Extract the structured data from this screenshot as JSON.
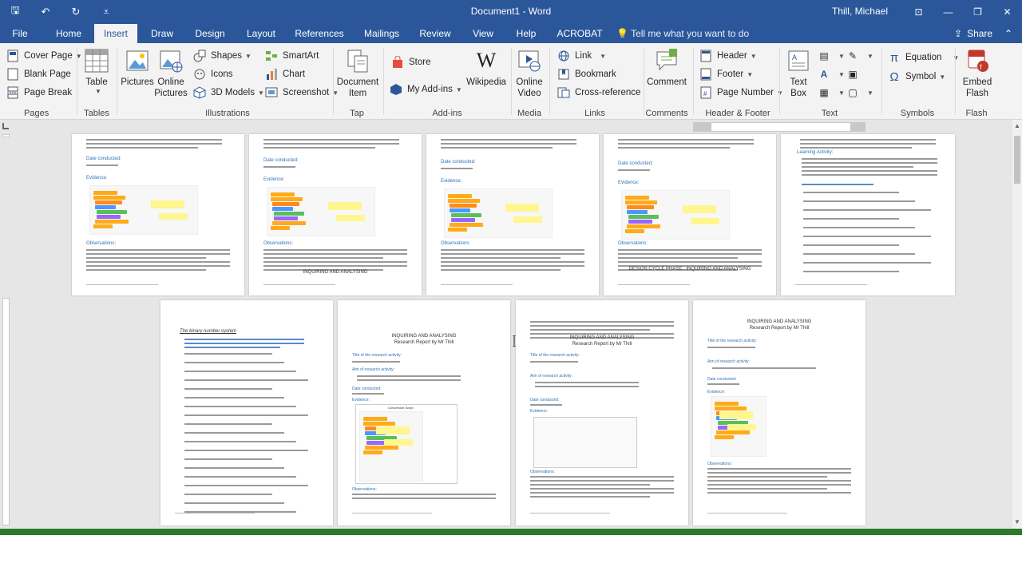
{
  "titlebar": {
    "doc_title": "Document1 - Word",
    "user": "Thill, Michael",
    "qat": [
      {
        "name": "save-icon",
        "glyph": "🖫"
      },
      {
        "name": "undo-icon",
        "glyph": "↶"
      },
      {
        "name": "redo-icon",
        "glyph": "↻"
      },
      {
        "name": "customize-qat-icon",
        "glyph": "⩡"
      }
    ],
    "window_controls": [
      {
        "name": "ribbon-display-options-icon",
        "glyph": "⊡"
      },
      {
        "name": "minimize-icon",
        "glyph": "—"
      },
      {
        "name": "restore-icon",
        "glyph": "❐"
      },
      {
        "name": "close-icon",
        "glyph": "✕"
      }
    ]
  },
  "tabs": {
    "items": [
      "File",
      "Home",
      "Insert",
      "Draw",
      "Design",
      "Layout",
      "References",
      "Mailings",
      "Review",
      "View",
      "Help",
      "ACROBAT"
    ],
    "active": "Insert",
    "tell_me": "Tell me what you want to do",
    "share": "Share"
  },
  "ribbon": {
    "pages": {
      "label": "Pages",
      "cover_page": "Cover Page",
      "blank_page": "Blank Page",
      "page_break": "Page Break"
    },
    "tables": {
      "label": "Tables",
      "table": "Table"
    },
    "illustrations": {
      "label": "Illustrations",
      "pictures": "Pictures",
      "online_pictures_1": "Online",
      "online_pictures_2": "Pictures",
      "shapes": "Shapes",
      "icons": "Icons",
      "models_3d": "3D Models",
      "smartart": "SmartArt",
      "chart": "Chart",
      "screenshot": "Screenshot"
    },
    "tap": {
      "label": "Tap",
      "document_item_1": "Document",
      "document_item_2": "Item"
    },
    "addins": {
      "label": "Add-ins",
      "store": "Store",
      "my_addins": "My Add-ins",
      "wikipedia": "Wikipedia"
    },
    "media": {
      "label": "Media",
      "online_video_1": "Online",
      "online_video_2": "Video"
    },
    "links": {
      "label": "Links",
      "link": "Link",
      "bookmark": "Bookmark",
      "cross_reference": "Cross-reference"
    },
    "comments": {
      "label": "Comments",
      "comment": "Comment"
    },
    "header_footer": {
      "label": "Header & Footer",
      "header": "Header",
      "footer": "Footer",
      "page_number": "Page Number"
    },
    "text": {
      "label": "Text",
      "text_box_1": "Text",
      "text_box_2": "Box"
    },
    "symbols": {
      "label": "Symbols",
      "equation": "Equation",
      "symbol": "Symbol"
    },
    "flash": {
      "label": "Flash",
      "embed_flash_1": "Embed",
      "embed_flash_2": "Flash"
    }
  },
  "pages": {
    "design_cycle": "DESIGN CYCLE PHASE : INQUIRING AND ANALYSING",
    "inquiring": "INQUIRING AND ANALYSING",
    "research_report": "Research Report by Mr Thill",
    "observations": "Observations:",
    "evidence": "Evidence:",
    "date_conducted": "Date conducted:",
    "title_research": "Title of the research activity:",
    "aim_research": "Aim of research activity:",
    "learning_activity": "Learning Activity:",
    "binary_number_system": "The binary number system",
    "conversion_script": "Conversion Script"
  },
  "colors": {
    "brand": "#2b579a",
    "ribbon_bg": "#f3f3f3",
    "doc_bg": "#e6e6e6",
    "status": "#2b7a2b",
    "heading_blue": "#2e74b5"
  }
}
